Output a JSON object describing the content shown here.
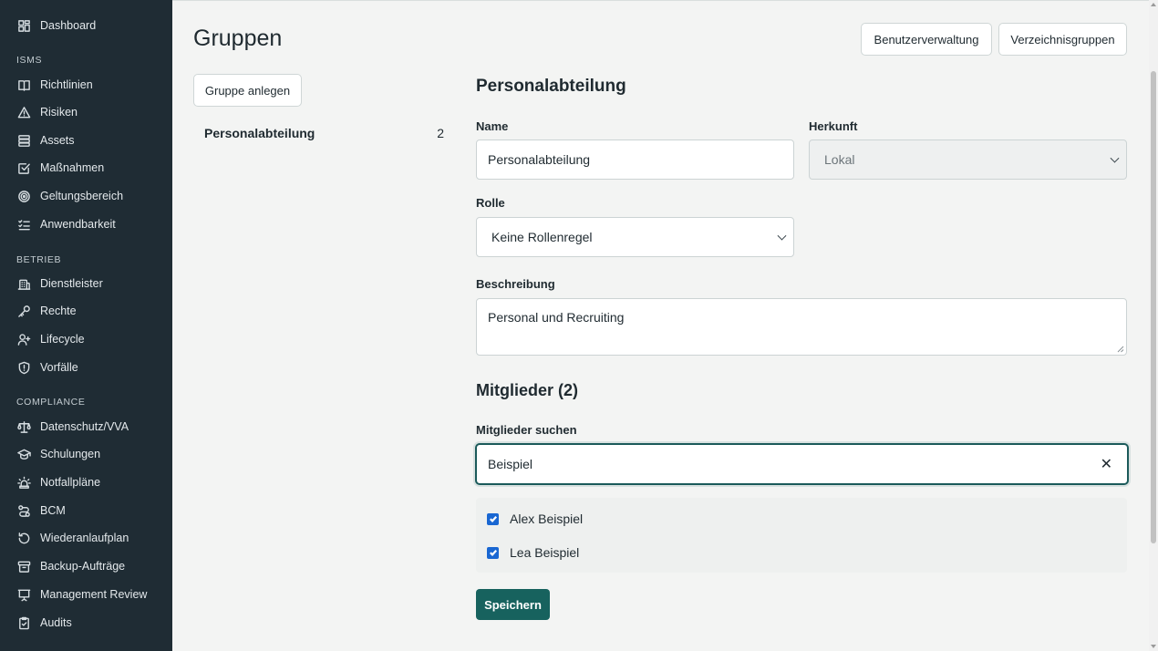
{
  "sidebar": {
    "top_item": {
      "label": "Dashboard",
      "icon": "grid-icon"
    },
    "sections": [
      {
        "title": "ISMS",
        "items": [
          {
            "label": "Richtlinien",
            "icon": "book-icon"
          },
          {
            "label": "Risiken",
            "icon": "warning-triangle-icon"
          },
          {
            "label": "Assets",
            "icon": "server-icon"
          },
          {
            "label": "Maßnahmen",
            "icon": "checkbox-icon"
          },
          {
            "label": "Geltungsbereich",
            "icon": "target-icon"
          },
          {
            "label": "Anwendbarkeit",
            "icon": "checklist-icon"
          }
        ]
      },
      {
        "title": "BETRIEB",
        "items": [
          {
            "label": "Dienstleister",
            "icon": "building-icon"
          },
          {
            "label": "Rechte",
            "icon": "key-icon"
          },
          {
            "label": "Lifecycle",
            "icon": "user-plus-icon"
          },
          {
            "label": "Vorfälle",
            "icon": "shield-alert-icon"
          }
        ]
      },
      {
        "title": "COMPLIANCE",
        "items": [
          {
            "label": "Datenschutz/VVA",
            "icon": "scale-icon"
          },
          {
            "label": "Schulungen",
            "icon": "graduation-cap-icon"
          },
          {
            "label": "Notfallpläne",
            "icon": "siren-icon"
          },
          {
            "label": "BCM",
            "icon": "route-icon"
          },
          {
            "label": "Wiederanlaufplan",
            "icon": "restore-icon"
          },
          {
            "label": "Backup-Aufträge",
            "icon": "archive-icon"
          },
          {
            "label": "Management Review",
            "icon": "presentation-icon"
          },
          {
            "label": "Audits",
            "icon": "clipboard-icon"
          }
        ]
      }
    ]
  },
  "header": {
    "title": "Gruppen",
    "user_management_label": "Benutzerverwaltung",
    "directory_groups_label": "Verzeichnisgruppen"
  },
  "groups": {
    "create_label": "Gruppe anlegen",
    "items": [
      {
        "name": "Personalabteilung",
        "count": "2"
      }
    ]
  },
  "detail": {
    "title": "Personalabteilung",
    "name_label": "Name",
    "name_value": "Personalabteilung",
    "origin_label": "Herkunft",
    "origin_value": "Lokal",
    "role_label": "Rolle",
    "role_value": "Keine Rollenregel",
    "description_label": "Beschreibung",
    "description_value": "Personal und Recruiting",
    "members_title": "Mitglieder (2)",
    "search_label": "Mitglieder suchen",
    "search_value": "Beispiel",
    "members": [
      {
        "name": "Alex Beispiel",
        "checked": true
      },
      {
        "name": "Lea Beispiel",
        "checked": true
      }
    ],
    "save_label": "Speichern"
  },
  "colors": {
    "sidebar_bg": "#1f2c34",
    "primary": "#17625e",
    "checkbox": "#1967d2"
  }
}
